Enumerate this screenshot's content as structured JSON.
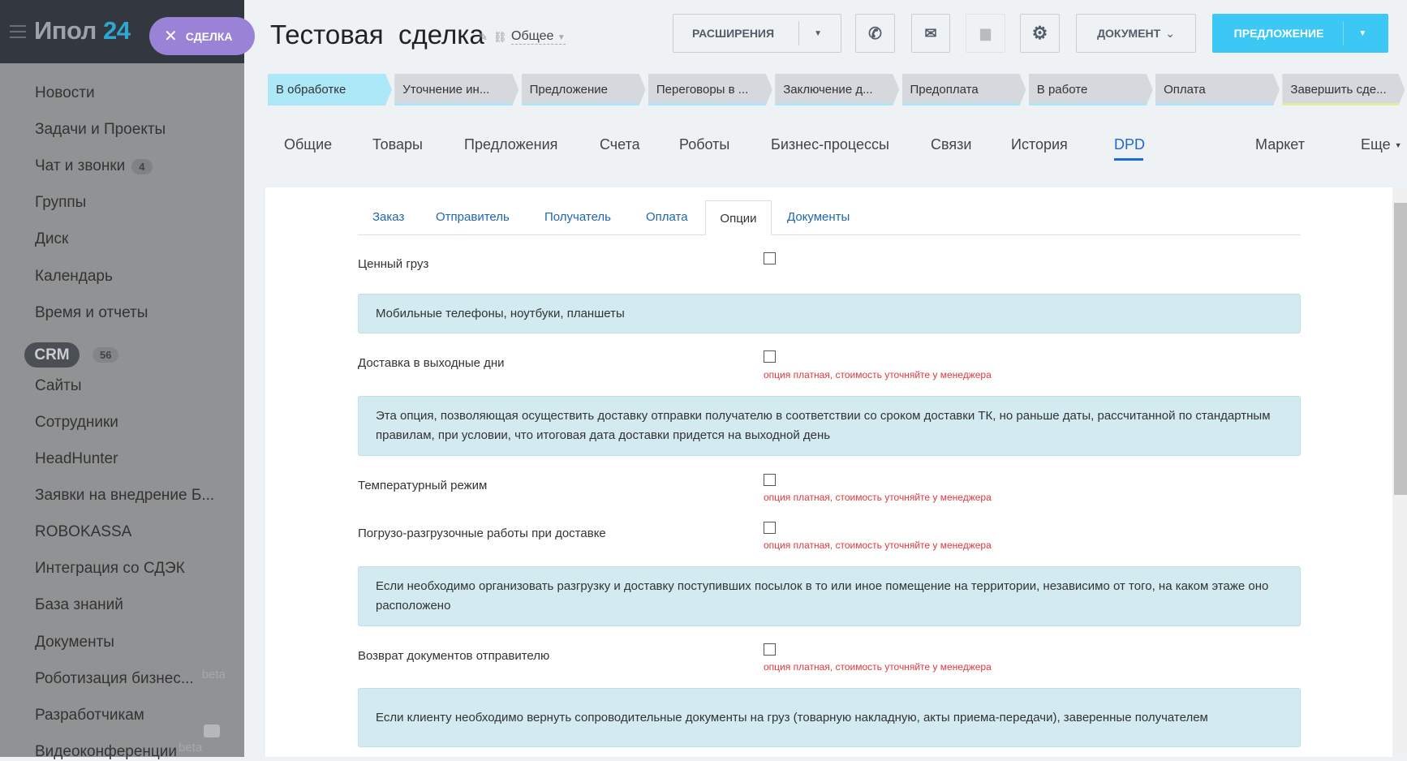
{
  "logo": {
    "name": "Ипол",
    "num": "24"
  },
  "pill": {
    "icon": "close-icon",
    "label": "СДЕЛКА"
  },
  "sidebar": {
    "items": [
      {
        "label": "Новости"
      },
      {
        "label": "Задачи и Проекты"
      },
      {
        "label": "Чат и звонки",
        "badge": "4"
      },
      {
        "label": "Группы"
      },
      {
        "label": "Диск"
      },
      {
        "label": "Календарь"
      },
      {
        "label": "Время и отчеты"
      },
      {
        "label": "CRM",
        "badge": "56"
      },
      {
        "label": "Сайты"
      },
      {
        "label": "Сотрудники"
      },
      {
        "label": "HeadHunter"
      },
      {
        "label": "Заявки на внедрение Б..."
      },
      {
        "label": "ROBOKASSA"
      },
      {
        "label": "Интеграция со СДЭК"
      },
      {
        "label": "База знаний"
      },
      {
        "label": "Документы"
      },
      {
        "label": "Роботизация бизнес...",
        "beta": "beta"
      },
      {
        "label": "Разработчикам"
      },
      {
        "label": "Видеоконференции",
        "beta": "beta"
      }
    ]
  },
  "header": {
    "title": "Тестовая  сделка",
    "category": "Общее",
    "extensions": "РАСШИРЕНИЯ",
    "document": "ДОКУМЕНТ",
    "proposal": "ПРЕДЛОЖЕНИЕ"
  },
  "stages": [
    "В обработке",
    "Уточнение ин...",
    "Предложение",
    "Переговоры в ...",
    "Заключение д...",
    "Предоплата",
    "В работе",
    "Оплата",
    "Завершить сде..."
  ],
  "tabs": [
    "Общие",
    "Товары",
    "Предложения",
    "Счета",
    "Роботы",
    "Бизнес-процессы",
    "Связи",
    "История",
    "DPD",
    "Маркет",
    "Еще"
  ],
  "subtabs": [
    "Заказ",
    "Отправитель",
    "Получатель",
    "Оплата",
    "Опции",
    "Документы"
  ],
  "options": {
    "paid_note": "опция платная, стоимость уточняйте у менеджера",
    "valuable": "Ценный груз",
    "valuable_info": "Мобильные телефоны, ноутбуки, планшеты",
    "weekend": "Доставка в выходные дни",
    "weekend_info": "Эта опция, позволяющая осуществить доставку отправки получателю в соответствии со сроком доставки ТК, но раньше даты, рассчитанной по стандартным правилам, при условии, что итоговая дата доставки придется на выходной день",
    "temperature": "Температурный режим",
    "loading": "Погрузо-разгрузочные работы при доставке",
    "loading_info": "Если необходимо организовать разгрузку и доставку поступивших посылок в то или иное помещение на территории, независимо от того, на каком этаже оно расположено",
    "return_docs": "Возврат документов отправителю",
    "return_info": "Если клиенту необходимо вернуть сопроводительные документы на груз (товарную накладную, акты приема-передачи), заверенные получателем"
  },
  "colors": {
    "accent": "#3bc8f5",
    "active_stage": "#ace8f8",
    "pill": "#9a82d6",
    "link": "#2067b0",
    "note": "#e0393e"
  }
}
